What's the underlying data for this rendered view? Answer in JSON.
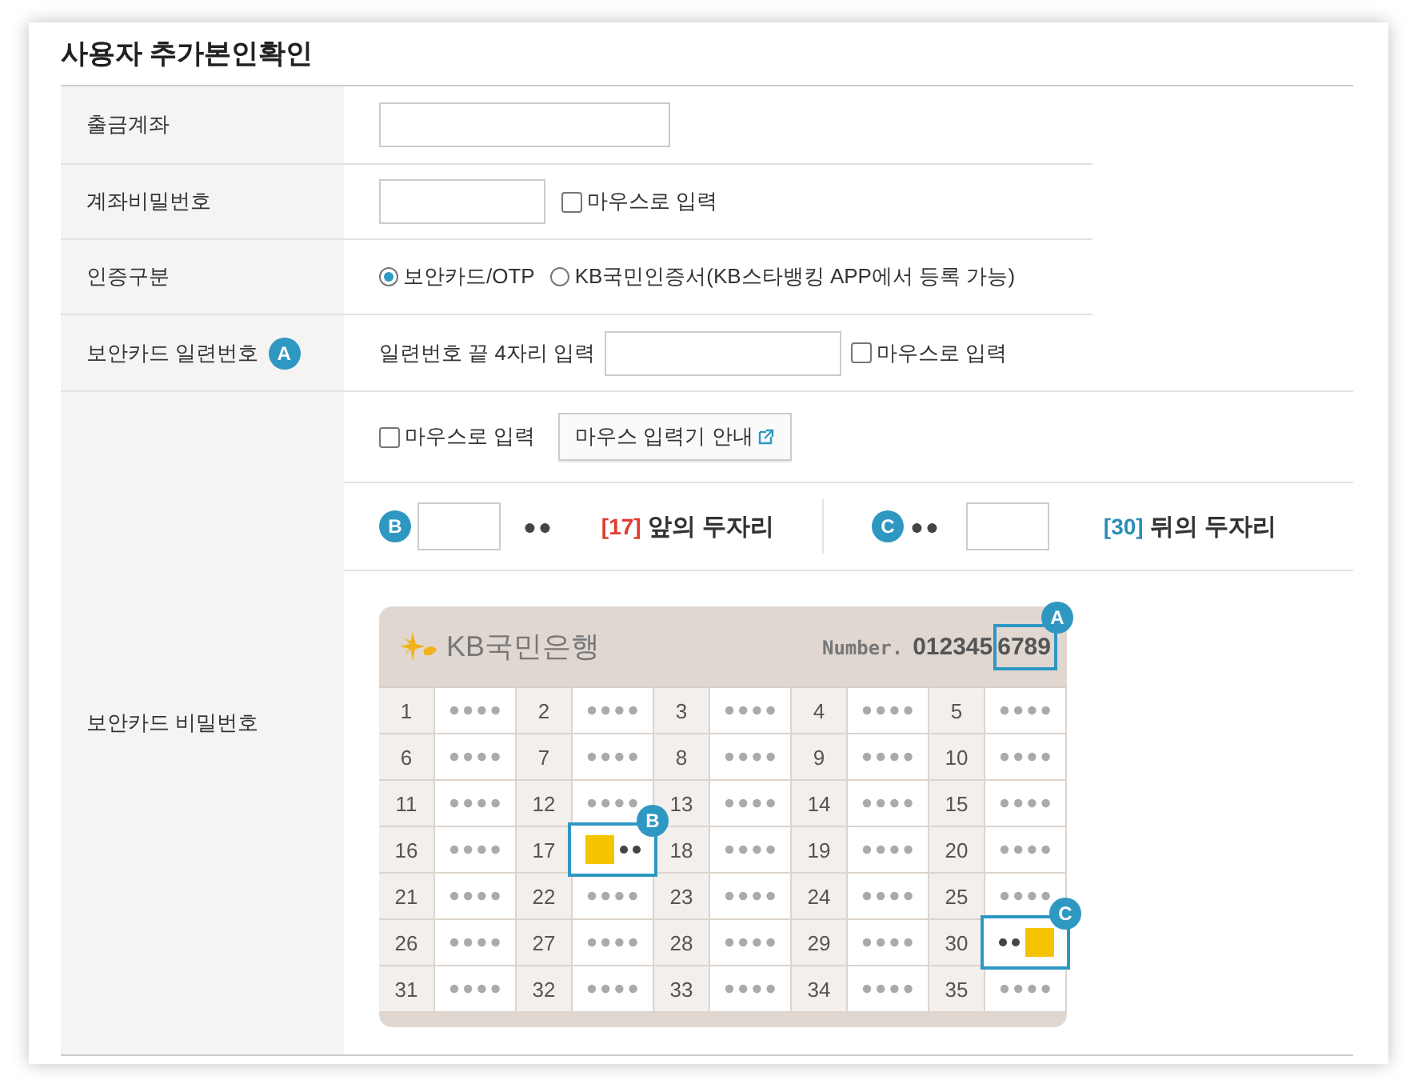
{
  "title": "사용자 추가본인확인",
  "rows": [
    {
      "kind": "account",
      "label": "출금계좌"
    },
    {
      "kind": "password",
      "label": "계좌비밀번호",
      "mouse_input": {
        "label": "마우스로 입력",
        "checked": false
      }
    },
    {
      "kind": "auth",
      "label": "인증구분",
      "options": [
        {
          "label": "보안카드/OTP",
          "selected": true
        },
        {
          "label": "KB국민인증서(KB스타뱅킹 APP에서 등록 가능)",
          "selected": false
        }
      ]
    },
    {
      "kind": "serial",
      "label": "보안카드 일련번호",
      "marker": "A",
      "prompt": "일련번호 끝 4자리 입력",
      "mouse_input": {
        "label": "마우스로 입력",
        "checked": false
      }
    },
    {
      "kind": "card",
      "label": "보안카드 비밀번호",
      "mouse_input": {
        "label": "마우스로 입력",
        "checked": false
      },
      "guide_button": "마우스 입력기 안내",
      "front": {
        "marker": "B",
        "dots": "●●",
        "index": "[17]",
        "text": "앞의 두자리"
      },
      "back": {
        "marker": "C",
        "dots": "●●",
        "index": "[30]",
        "text": "뒤의 두자리"
      },
      "card": {
        "bank": "KB국민은행",
        "number_label": "Number.",
        "number": "012345",
        "number_highlight": "6789",
        "marker": "A",
        "cells": [
          {
            "number": "1",
            "kind": "hidden"
          },
          {
            "number": "2",
            "kind": "hidden"
          },
          {
            "number": "3",
            "kind": "hidden"
          },
          {
            "number": "4",
            "kind": "hidden"
          },
          {
            "number": "5",
            "kind": "hidden"
          },
          {
            "number": "6",
            "kind": "hidden"
          },
          {
            "number": "7",
            "kind": "hidden"
          },
          {
            "number": "8",
            "kind": "hidden"
          },
          {
            "number": "9",
            "kind": "hidden"
          },
          {
            "number": "10",
            "kind": "hidden"
          },
          {
            "number": "11",
            "kind": "hidden"
          },
          {
            "number": "12",
            "kind": "hidden"
          },
          {
            "number": "13",
            "kind": "hidden"
          },
          {
            "number": "14",
            "kind": "hidden"
          },
          {
            "number": "15",
            "kind": "hidden"
          },
          {
            "number": "16",
            "kind": "hidden"
          },
          {
            "number": "17",
            "kind": "front",
            "marker": "B"
          },
          {
            "number": "18",
            "kind": "hidden"
          },
          {
            "number": "19",
            "kind": "hidden"
          },
          {
            "number": "20",
            "kind": "hidden"
          },
          {
            "number": "21",
            "kind": "hidden"
          },
          {
            "number": "22",
            "kind": "hidden"
          },
          {
            "number": "23",
            "kind": "hidden"
          },
          {
            "number": "24",
            "kind": "hidden"
          },
          {
            "number": "25",
            "kind": "hidden"
          },
          {
            "number": "26",
            "kind": "hidden"
          },
          {
            "number": "27",
            "kind": "hidden"
          },
          {
            "number": "28",
            "kind": "hidden"
          },
          {
            "number": "29",
            "kind": "hidden"
          },
          {
            "number": "30",
            "kind": "back",
            "marker": "C"
          },
          {
            "number": "31",
            "kind": "hidden"
          },
          {
            "number": "32",
            "kind": "hidden"
          },
          {
            "number": "33",
            "kind": "hidden"
          },
          {
            "number": "34",
            "kind": "hidden"
          },
          {
            "number": "35",
            "kind": "hidden"
          }
        ]
      }
    }
  ]
}
